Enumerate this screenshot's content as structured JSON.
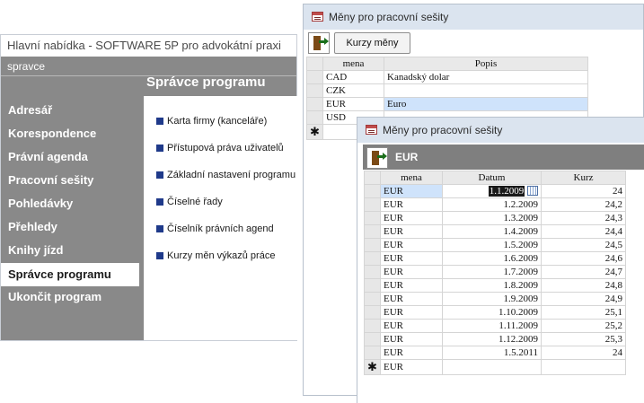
{
  "main_window": {
    "title": "Hlavní nabídka - SOFTWARE 5P pro advokátní praxi",
    "user": "spravce",
    "nav": [
      {
        "label": "Adresář",
        "active": false
      },
      {
        "label": "Korespondence",
        "active": false
      },
      {
        "label": "Právní agenda",
        "active": false
      },
      {
        "label": "Pracovní sešity",
        "active": false
      },
      {
        "label": "Pohledávky",
        "active": false
      },
      {
        "label": "Přehledy",
        "active": false
      },
      {
        "label": "Knihy jízd",
        "active": false
      },
      {
        "label": "Správce programu",
        "active": true
      },
      {
        "label": "Ukončit program",
        "active": false
      }
    ],
    "panel_title": "Správce programu",
    "panel_items": [
      "Karta firmy (kanceláře)",
      "Přístupová práva uživatelů",
      "Základní nastavení programu",
      "Číselné řady",
      "Číselník právních agend",
      "Kurzy měn výkazů práce"
    ]
  },
  "currency_form": {
    "title": "Měny pro pracovní sešity",
    "kurzy_button": "Kurzy měny",
    "columns": [
      "mena",
      "Popis"
    ],
    "rows": [
      {
        "mena": "CAD",
        "popis": "Kanadský dolar"
      },
      {
        "mena": "CZK",
        "popis": ""
      },
      {
        "mena": "EUR",
        "popis": "Euro"
      },
      {
        "mena": "USD",
        "popis": ""
      }
    ],
    "new_row_marker": "✱"
  },
  "rate_form": {
    "title": "Měny pro pracovní sešity",
    "header": "EUR",
    "columns": [
      "mena",
      "Datum",
      "Kurz"
    ],
    "rows": [
      {
        "mena": "EUR",
        "datum": "1.1.2009",
        "kurz": "24"
      },
      {
        "mena": "EUR",
        "datum": "1.2.2009",
        "kurz": "24,2"
      },
      {
        "mena": "EUR",
        "datum": "1.3.2009",
        "kurz": "24,3"
      },
      {
        "mena": "EUR",
        "datum": "1.4.2009",
        "kurz": "24,4"
      },
      {
        "mena": "EUR",
        "datum": "1.5.2009",
        "kurz": "24,5"
      },
      {
        "mena": "EUR",
        "datum": "1.6.2009",
        "kurz": "24,6"
      },
      {
        "mena": "EUR",
        "datum": "1.7.2009",
        "kurz": "24,7"
      },
      {
        "mena": "EUR",
        "datum": "1.8.2009",
        "kurz": "24,8"
      },
      {
        "mena": "EUR",
        "datum": "1.9.2009",
        "kurz": "24,9"
      },
      {
        "mena": "EUR",
        "datum": "1.10.2009",
        "kurz": "25,1"
      },
      {
        "mena": "EUR",
        "datum": "1.11.2009",
        "kurz": "25,2"
      },
      {
        "mena": "EUR",
        "datum": "1.12.2009",
        "kurz": "25,3"
      },
      {
        "mena": "EUR",
        "datum": "1.5.2011",
        "kurz": "24"
      }
    ],
    "new_row_mena": "EUR",
    "new_row_marker": "✱"
  },
  "icons": [
    "form-icon",
    "exit-icon",
    "calendar-icon",
    "bullet-icon"
  ],
  "colors": {
    "menu_gray": "#898989",
    "bullet_blue": "#1f3a8a",
    "title_bar": "#dbe4ef",
    "header_band": "#7f7f7f",
    "sorted_column": "#fde07c",
    "row_highlight": "#cfe3fb"
  }
}
